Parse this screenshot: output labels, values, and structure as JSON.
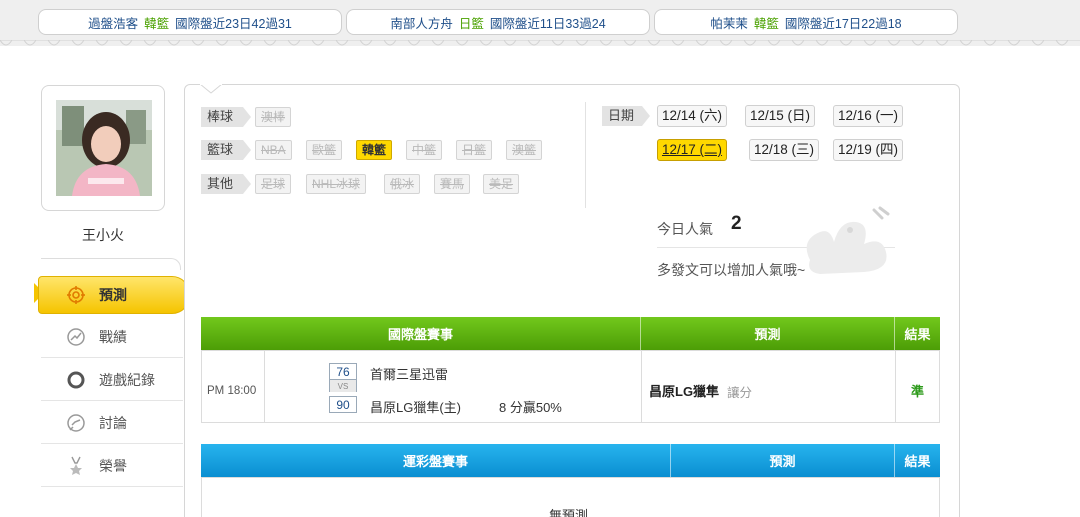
{
  "ticker": [
    {
      "who": "過盤浩客",
      "category": "韓籃",
      "record": "國際盤近23日42過31"
    },
    {
      "who": "南部人方舟",
      "category": "日籃",
      "record": "國際盤近11日33過24"
    },
    {
      "who": "帕茉茉",
      "category": "韓籃",
      "record": "國際盤近17日22過18"
    }
  ],
  "profile": {
    "username": "王小火"
  },
  "nav": [
    {
      "label": "預測",
      "icon": "target-icon",
      "active": true
    },
    {
      "label": "戰績",
      "icon": "chart-icon"
    },
    {
      "label": "遊戲紀錄",
      "icon": "circle-icon"
    },
    {
      "label": "討論",
      "icon": "discussion-icon"
    },
    {
      "label": "榮譽",
      "icon": "medal-icon"
    }
  ],
  "filters": {
    "baseball": {
      "label": "棒球",
      "items": [
        "澳棒"
      ]
    },
    "basketball": {
      "label": "籃球",
      "items": [
        "NBA",
        "歐籃",
        "韓籃",
        "中籃",
        "日籃",
        "澳籃"
      ],
      "active": "韓籃"
    },
    "other": {
      "label": "其他",
      "items": [
        "足球",
        "NHL冰球",
        "俄冰",
        "賽馬",
        "美足"
      ]
    }
  },
  "dates": {
    "label": "日期",
    "items": [
      "12/14 (六)",
      "12/15 (日)",
      "12/16 (一)",
      "12/17 (二)",
      "12/18 (三)",
      "12/19 (四)"
    ],
    "active": "12/17 (二)"
  },
  "popularity": {
    "label": "今日人氣",
    "value": "2",
    "hint": "多發文可以增加人氣哦~"
  },
  "intl_table": {
    "headers": [
      "國際盤賽事",
      "預測",
      "結果"
    ],
    "row": {
      "time": "PM 18:00",
      "away_score": "76",
      "vs": "VS",
      "home_score": "90",
      "away_team": "首爾三星迅雷",
      "home_team": "昌原LG獵隼(主)",
      "spread": "8 分贏50%",
      "pick_team": "昌原LG獵隼",
      "pick_type": "讓分",
      "result": "準"
    }
  },
  "lottery_table": {
    "headers": [
      "運彩盤賽事",
      "預測",
      "結果"
    ],
    "empty_text": "無預測"
  },
  "colors": {
    "green_header": "#5cb30f",
    "blue_header": "#12a0de",
    "active_yellow": "#ffd800"
  }
}
